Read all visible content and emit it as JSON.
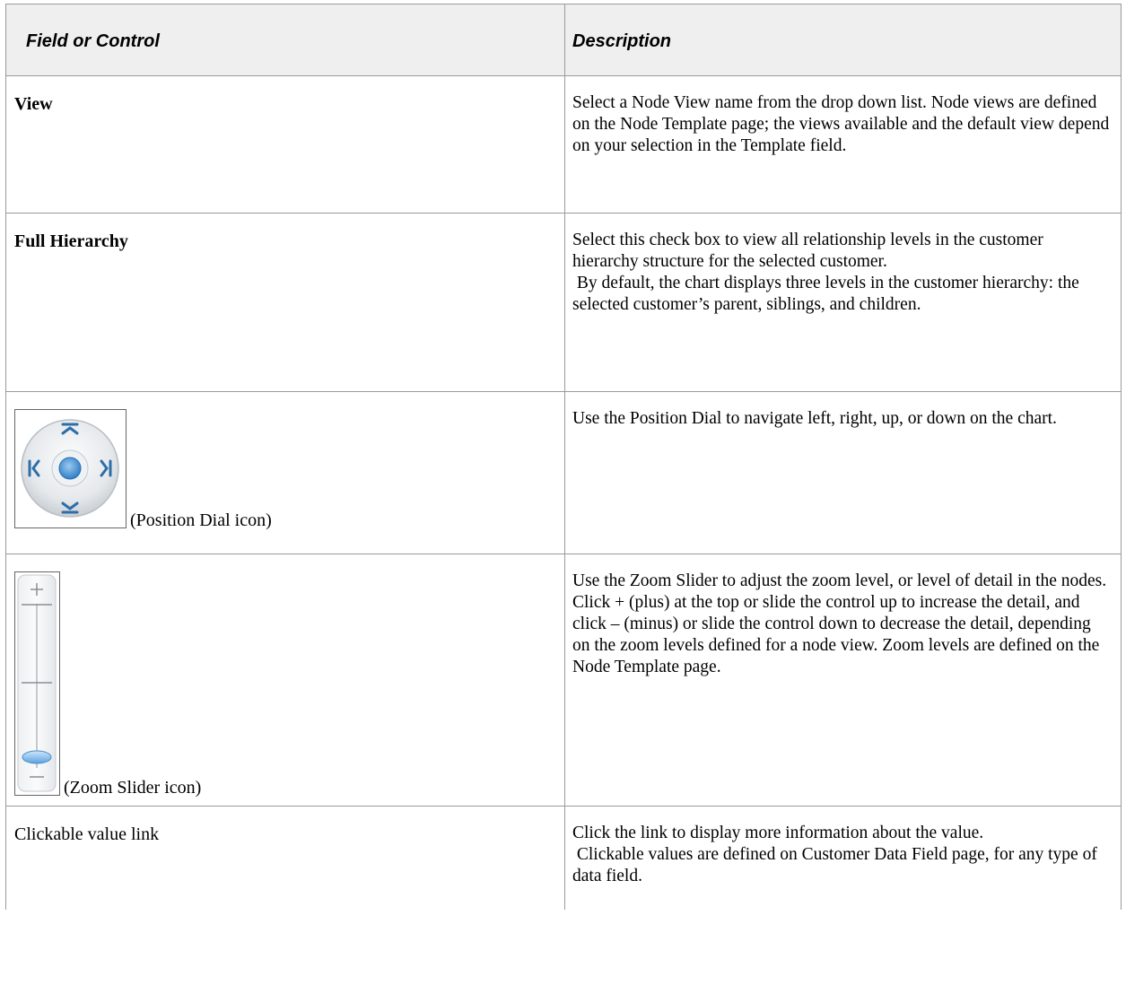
{
  "table": {
    "headers": {
      "field": "Field or Control",
      "description": "Description"
    },
    "rows": [
      {
        "field": "View",
        "description": "Select a Node View name from the drop down list. Node views are defined on the Node Template page; the views available and the default view depend on your selection in the Template field."
      },
      {
        "field": "Full Hierarchy",
        "description_lines": [
          "Select this check box to view all relationship levels in the customer hierarchy structure for the selected customer.",
          "By default, the chart displays three levels in the customer hierarchy: the selected customer’s parent, siblings, and children."
        ]
      },
      {
        "icon": "position-dial-icon",
        "caption": "(Position Dial icon)",
        "description": "Use the Position Dial to navigate left, right, up, or down on the chart."
      },
      {
        "icon": "zoom-slider-icon",
        "caption": "(Zoom Slider icon)",
        "description": "Use the Zoom Slider to adjust the zoom level, or level of detail in the nodes. Click + (plus) at the top or slide the control up to increase the detail, and click – (minus) or slide the control down to decrease the detail, depending on the zoom levels defined for a node view. Zoom levels are defined on the Node Template page."
      },
      {
        "field": "Clickable value link",
        "description_lines": [
          "Click the link to display more information about the value.",
          "Clickable values are defined on Customer Data Field page, for any type of data field."
        ]
      }
    ]
  },
  "colors": {
    "border": "#9a9a9a",
    "header_bg": "#efefef",
    "dial_accent": "#3b8fd6"
  }
}
